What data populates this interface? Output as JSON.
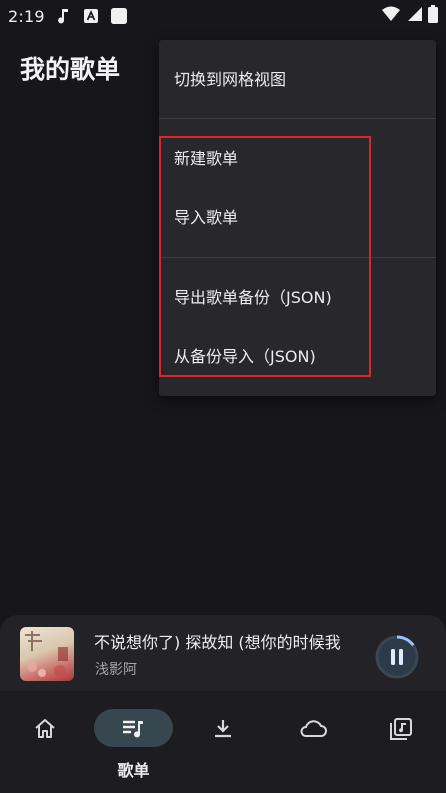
{
  "status_bar": {
    "time": "2:19",
    "icons_left": [
      "music-note-icon",
      "text-a-icon",
      "square-notification-icon"
    ],
    "icons_right": [
      "wifi-icon",
      "cellular-signal-icon",
      "battery-icon"
    ]
  },
  "page": {
    "title": "我的歌单"
  },
  "menu": {
    "items": [
      {
        "label": "切换到网格视图"
      },
      {
        "label": "新建歌单"
      },
      {
        "label": "导入歌单"
      },
      {
        "label": "导出歌单备份（JSON)"
      },
      {
        "label": "从备份导入（JSON)"
      }
    ],
    "highlight_color": "#d9282d"
  },
  "player": {
    "title": "不说想你了)   探故知 (想你的时候我",
    "artist": "浅影阿",
    "state": "playing",
    "progress": 0.15
  },
  "bottom_nav": {
    "items": [
      {
        "icon": "home-icon",
        "label": ""
      },
      {
        "icon": "playlist-icon",
        "label": "歌单",
        "active": true
      },
      {
        "icon": "download-icon",
        "label": ""
      },
      {
        "icon": "cloud-icon",
        "label": ""
      },
      {
        "icon": "music-library-icon",
        "label": ""
      }
    ],
    "active_pill_color": "#37474f"
  }
}
